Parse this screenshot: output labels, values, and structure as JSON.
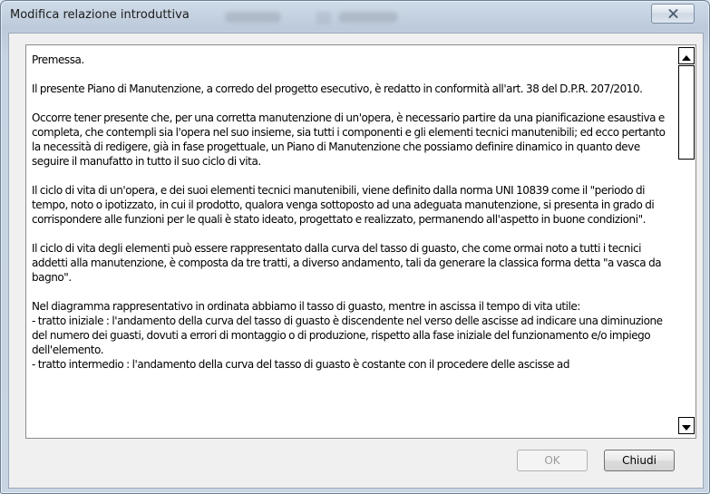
{
  "window": {
    "title": "Modifica relazione introduttiva",
    "close_icon": "close-x-icon"
  },
  "document": {
    "paragraphs": [
      "Premessa.",
      "Il presente Piano di Manutenzione, a corredo del progetto esecutivo, è redatto in conformità all'art. 38 del D.P.R. 207/2010.",
      "Occorre tener presente che, per una corretta manutenzione di un'opera, è necessario partire da una pianificazione esaustiva e completa, che contempli sia l'opera nel suo insieme, sia tutti i componenti e gli elementi tecnici manutenibili; ed ecco pertanto la necessità di redigere, già in fase progettuale, un Piano di Manutenzione che possiamo definire dinamico in quanto deve seguire il manufatto in tutto il suo ciclo di vita.",
      "Il ciclo di vita di un'opera, e dei suoi elementi tecnici manutenibili, viene definito dalla norma UNI 10839 come il \"periodo di tempo, noto o ipotizzato, in cui il prodotto, qualora venga sottoposto ad una adeguata manutenzione, si presenta in grado di corrispondere alle funzioni per le quali è stato ideato, progettato e realizzato, permanendo all'aspetto in buone condizioni\".",
      "Il ciclo di vita degli elementi può essere rappresentato dalla curva del tasso di guasto, che come ormai noto a tutti i tecnici addetti alla manutenzione, è composta da tre tratti, a diverso andamento, tali da generare la classica forma detta \"a vasca da bagno\".",
      "Nel diagramma rappresentativo in ordinata abbiamo il tasso di guasto, mentre in ascissa il tempo di vita utile:\n- tratto iniziale : l'andamento della curva del tasso di guasto è discendente nel verso delle ascisse ad indicare una diminuzione del numero dei guasti, dovuti a errori di montaggio o di produzione, rispetto alla fase iniziale del funzionamento e/o impiego dell'elemento.\n- tratto intermedio : l'andamento della curva del tasso di guasto è costante con il procedere delle ascisse ad"
    ]
  },
  "scrollbar": {
    "up_icon": "scroll-up-arrow-icon",
    "down_icon": "scroll-down-arrow-icon"
  },
  "buttons": {
    "ok_label": "OK",
    "ok_enabled": false,
    "close_label": "Chiudi"
  }
}
